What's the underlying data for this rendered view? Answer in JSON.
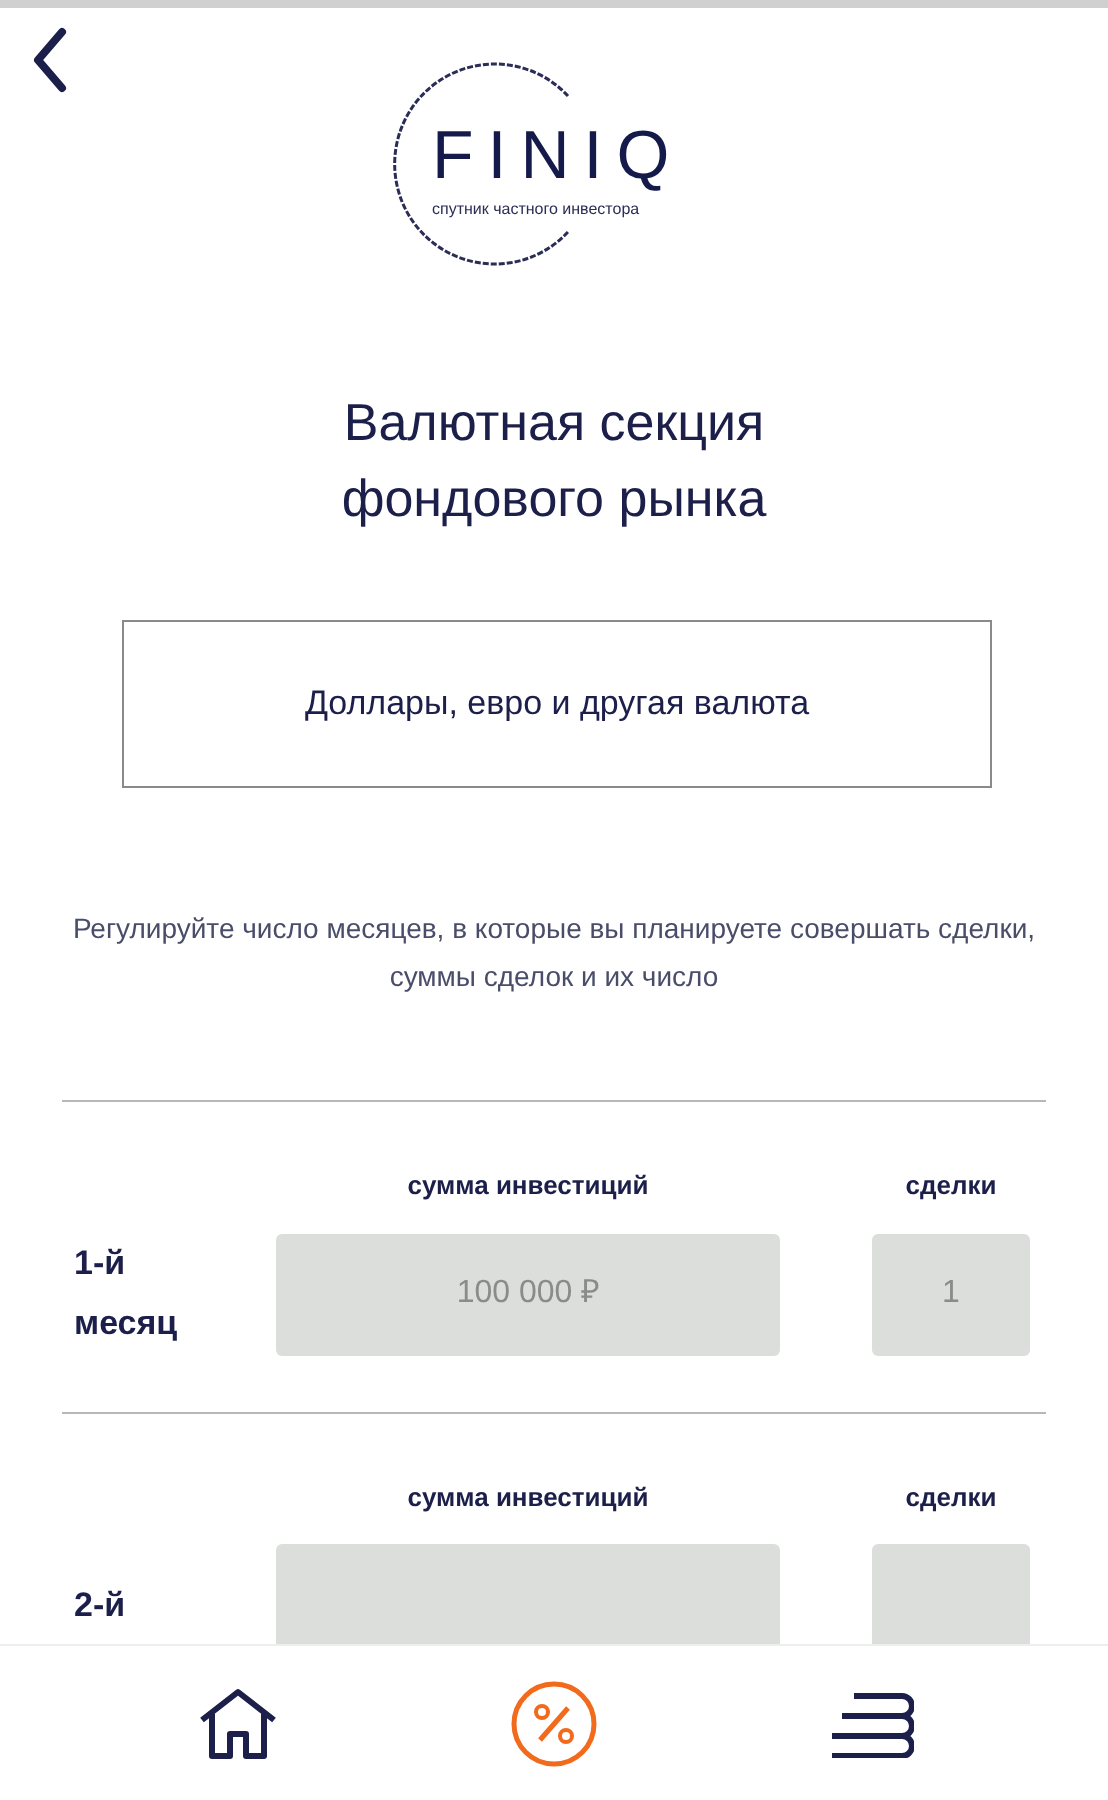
{
  "logo": {
    "name": "FINIQ",
    "tagline": "спутник частного инвестора"
  },
  "title": "Валютная секция фондового рынка",
  "section_button": "Доллары, евро и другая валюта",
  "description": "Регулируйте число месяцев, в которые вы планируете совершать сделки, суммы сделок и их число",
  "months": [
    {
      "label": "1-й месяц",
      "amount_header": "сумма инвестиций",
      "deals_header": "сделки",
      "amount": "100 000 ₽",
      "deals": "1"
    },
    {
      "label": "2-й",
      "amount_header": "сумма инвестиций",
      "deals_header": "сделки"
    }
  ],
  "nav": [
    {
      "kind": "home",
      "selected": false
    },
    {
      "kind": "percent",
      "selected": true
    },
    {
      "kind": "books",
      "selected": false
    }
  ]
}
